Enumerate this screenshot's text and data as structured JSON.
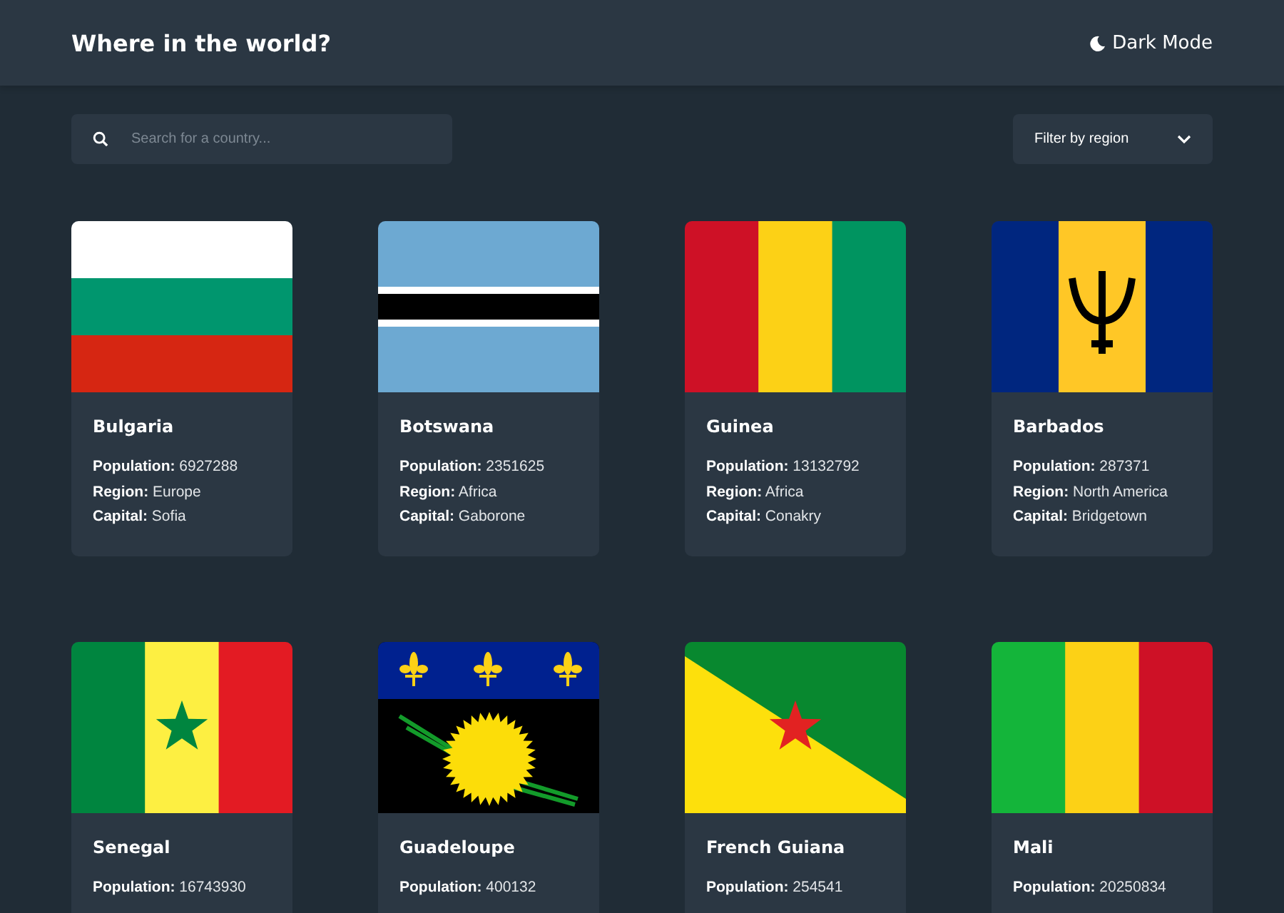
{
  "header": {
    "title": "Where in the world?",
    "theme_toggle": "Dark Mode"
  },
  "search": {
    "placeholder": "Search for a country..."
  },
  "filter": {
    "label": "Filter by region"
  },
  "countries": [
    {
      "name": "Bulgaria",
      "kind": "bg",
      "facts": [
        {
          "label": "Population:",
          "value": "6927288"
        },
        {
          "label": "Region:",
          "value": "Europe"
        },
        {
          "label": "Capital:",
          "value": "Sofia"
        }
      ]
    },
    {
      "name": "Botswana",
      "kind": "bw",
      "facts": [
        {
          "label": "Population:",
          "value": "2351625"
        },
        {
          "label": "Region:",
          "value": "Africa"
        },
        {
          "label": "Capital:",
          "value": "Gaborone"
        }
      ]
    },
    {
      "name": "Guinea",
      "kind": "gn",
      "facts": [
        {
          "label": "Population:",
          "value": "13132792"
        },
        {
          "label": "Region:",
          "value": "Africa"
        },
        {
          "label": "Capital:",
          "value": "Conakry"
        }
      ]
    },
    {
      "name": "Barbados",
      "kind": "bb",
      "facts": [
        {
          "label": "Population:",
          "value": "287371"
        },
        {
          "label": "Region:",
          "value": "North America"
        },
        {
          "label": "Capital:",
          "value": "Bridgetown"
        }
      ]
    },
    {
      "name": "Senegal",
      "kind": "sn",
      "facts": [
        {
          "label": "Population:",
          "value": "16743930"
        }
      ]
    },
    {
      "name": "Guadeloupe",
      "kind": "gp",
      "facts": [
        {
          "label": "Population:",
          "value": "400132"
        }
      ]
    },
    {
      "name": "French Guiana",
      "kind": "gf",
      "facts": [
        {
          "label": "Population:",
          "value": "254541"
        }
      ]
    },
    {
      "name": "Mali",
      "kind": "ml",
      "facts": [
        {
          "label": "Population:",
          "value": "20250834"
        }
      ]
    }
  ]
}
